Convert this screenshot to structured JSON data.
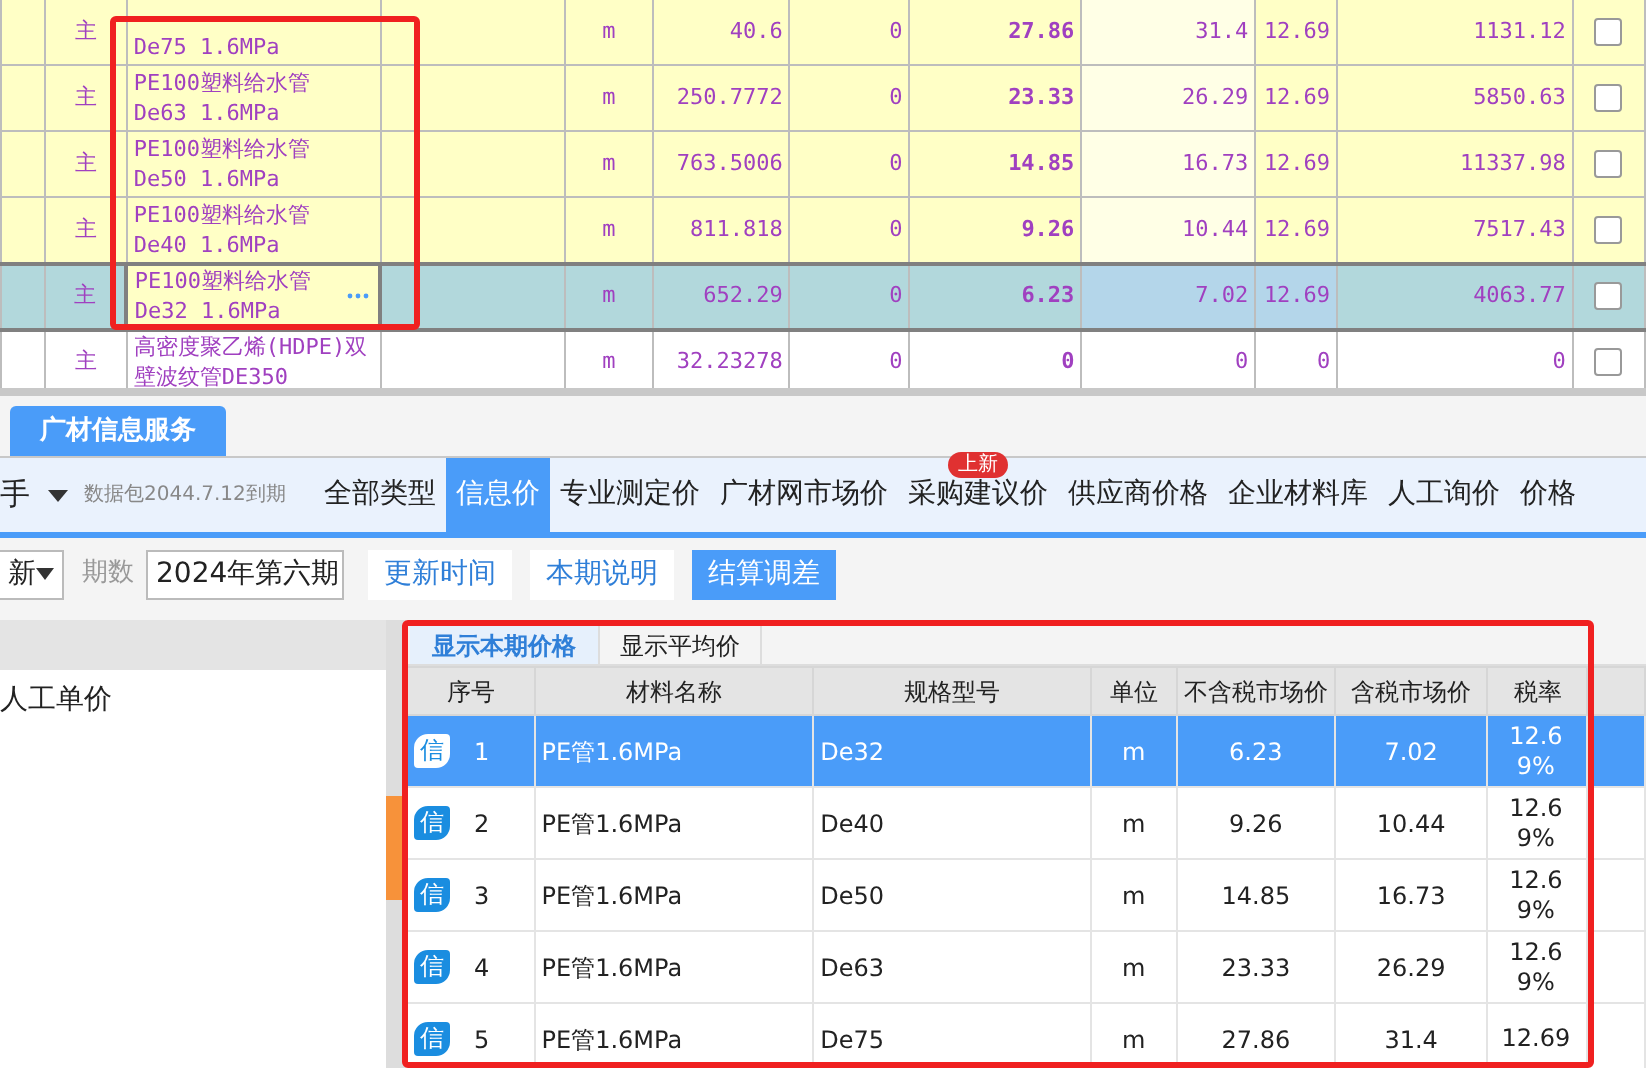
{
  "grid": {
    "rows": [
      {
        "type": "主",
        "spec": "De75 1.6MPa",
        "unit": "m",
        "quantity": "40.6",
        "column_7": "0",
        "price": "27.86",
        "tax_price": "31.4",
        "tax_rate": "12.69",
        "total": "1131.12",
        "highlighted": true,
        "selected": false,
        "checked": false
      },
      {
        "type": "主",
        "name": "PE100塑料给水管",
        "spec": "De63 1.6MPa",
        "unit": "m",
        "quantity": "250.7772",
        "column_7": "0",
        "price": "23.33",
        "tax_price": "26.29",
        "tax_rate": "12.69",
        "total": "5850.63",
        "highlighted": true,
        "selected": false,
        "checked": false
      },
      {
        "type": "主",
        "name": "PE100塑料给水管",
        "spec": "De50 1.6MPa",
        "unit": "m",
        "quantity": "763.5006",
        "column_7": "0",
        "price": "14.85",
        "tax_price": "16.73",
        "tax_rate": "12.69",
        "total": "11337.98",
        "highlighted": true,
        "selected": false,
        "checked": false
      },
      {
        "type": "主",
        "name": "PE100塑料给水管",
        "spec": "De40 1.6MPa",
        "unit": "m",
        "quantity": "811.818",
        "column_7": "0",
        "price": "9.26",
        "tax_price": "10.44",
        "tax_rate": "12.69",
        "total": "7517.43",
        "highlighted": true,
        "selected": false,
        "checked": false
      },
      {
        "type": "主",
        "name": "PE100塑料给水管",
        "spec": "De32 1.6MPa",
        "unit": "m",
        "quantity": "652.29",
        "column_7": "0",
        "price": "6.23",
        "tax_price": "7.02",
        "tax_rate": "12.69",
        "total": "4063.77",
        "highlighted": true,
        "selected": true,
        "checked": false
      },
      {
        "type": "主",
        "name": "高密度聚乙烯(HDPE)双壁波纹管DE350",
        "unit": "m",
        "quantity": "32.23278",
        "column_7": "0",
        "price": "0",
        "tax_price": "0",
        "tax_rate": "0",
        "total": "0",
        "highlighted": false,
        "selected": false,
        "checked": false
      }
    ]
  },
  "panel_tab": {
    "label": "广材信息服务",
    "selected": true
  },
  "nav": {
    "assistant": "手",
    "package": "数据包2044.7.12到期",
    "tabs": [
      {
        "label": "全部类型",
        "selected": false
      },
      {
        "label": "信息价",
        "selected": true
      },
      {
        "label": "专业测定价",
        "selected": false
      },
      {
        "label": "广材网市场价",
        "selected": false
      },
      {
        "label": "采购建议价",
        "selected": false,
        "badge": "上新"
      },
      {
        "label": "供应商价格",
        "selected": false
      },
      {
        "label": "企业材料库",
        "selected": false
      },
      {
        "label": "人工询价",
        "selected": false
      },
      {
        "label": "价格",
        "selected": false
      }
    ]
  },
  "toolbar": {
    "region": "新",
    "period_label": "期数",
    "period": "2024年第六期",
    "buttons": [
      {
        "label": "更新时间",
        "selected": false
      },
      {
        "label": "本期说明",
        "selected": false
      },
      {
        "label": "结算调差",
        "selected": true
      }
    ]
  },
  "tree": {
    "items": [
      "人工单价"
    ]
  },
  "price_tabs": [
    {
      "label": "显示本期价格",
      "selected": true
    },
    {
      "label": "显示平均价",
      "selected": false
    }
  ],
  "prices": {
    "columns": [
      "序号",
      "材料名称",
      "规格型号",
      "单位",
      "不含税市场价",
      "含税市场价",
      "税率"
    ],
    "rows": [
      {
        "badge": "信",
        "no": "1",
        "name": "PE管1.6MPa",
        "spec": "De32",
        "unit": "m",
        "price": "6.23",
        "tax_price": "7.02",
        "tax_rate": "12.69%",
        "selected": true
      },
      {
        "badge": "信",
        "no": "2",
        "name": "PE管1.6MPa",
        "spec": "De40",
        "unit": "m",
        "price": "9.26",
        "tax_price": "10.44",
        "tax_rate": "12.69%",
        "selected": false
      },
      {
        "badge": "信",
        "no": "3",
        "name": "PE管1.6MPa",
        "spec": "De50",
        "unit": "m",
        "price": "14.85",
        "tax_price": "16.73",
        "tax_rate": "12.69%",
        "selected": false
      },
      {
        "badge": "信",
        "no": "4",
        "name": "PE管1.6MPa",
        "spec": "De63",
        "unit": "m",
        "price": "23.33",
        "tax_price": "26.29",
        "tax_rate": "12.69%",
        "selected": false
      },
      {
        "badge": "信",
        "no": "5",
        "name": "PE管1.6MPa",
        "spec": "De75",
        "unit": "m",
        "price": "27.86",
        "tax_price": "31.4",
        "tax_rate": "12.69",
        "selected": false
      }
    ]
  }
}
